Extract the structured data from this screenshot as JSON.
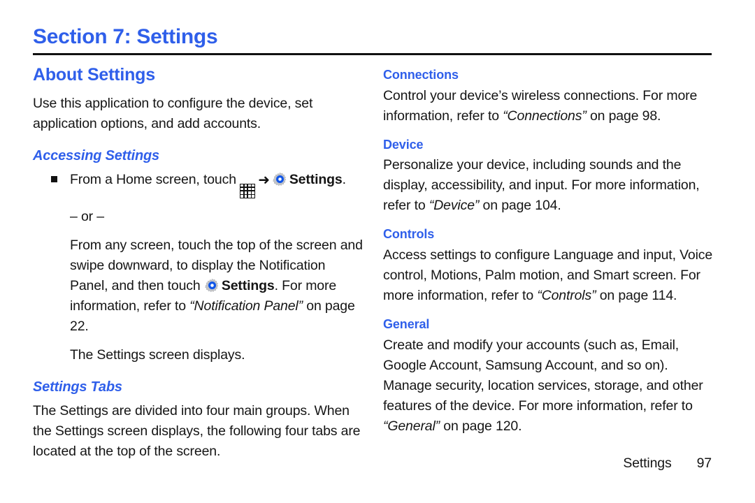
{
  "document": {
    "section_title": "Section 7: Settings",
    "accent_color": "#2F5FEA",
    "text_color": "#151515"
  },
  "left_column": {
    "heading": "About Settings",
    "intro": "Use this application to configure the device, set application options, and add accounts.",
    "accessing": {
      "heading": "Accessing Settings",
      "bullet_text_before_apps_icon": "From a Home screen, touch",
      "apps_icon_name": "apps-grid-icon",
      "arrow_glyph": "➜",
      "settings_icon_name": "settings-gear-icon",
      "bullet_settings_label": "Settings",
      "bullet_text_end": ".",
      "or_separator": "– or –",
      "alt_text_1": "From any screen, touch the top of the screen and swipe downward, to display the Notification Panel, and then touch",
      "alt_settings_label": "Settings",
      "alt_text_2": ". For more information, refer to",
      "alt_reference": "“Notification Panel”",
      "alt_text_3": "on page 22.",
      "result_text": "The Settings screen displays."
    },
    "settings_tabs": {
      "heading": "Settings Tabs",
      "body": "The Settings are divided into four main groups. When the Settings screen displays, the following four tabs are located at the top of the screen."
    }
  },
  "right_column": {
    "groups": [
      {
        "heading": "Connections",
        "text_before_ref": "Control your device’s wireless connections. For more information, refer to",
        "reference": "“Connections”",
        "text_after_ref": "on page 98."
      },
      {
        "heading": "Device",
        "text_before_ref": "Personalize your device, including sounds and the display, accessibility, and input. For more information, refer to",
        "reference": "“Device”",
        "text_after_ref": "on page 104."
      },
      {
        "heading": "Controls",
        "text_before_ref": "Access settings to configure Language and input, Voice control, Motions, Palm motion, and Smart screen. For more information, refer to",
        "reference": "“Controls”",
        "text_after_ref": "on page 114."
      },
      {
        "heading": "General",
        "text_before_ref": "Create and modify your accounts (such as, Email, Google Account, Samsung Account, and so on). Manage security, location services, storage, and other features of the device. For more information, refer to",
        "reference": "“General”",
        "text_after_ref": "on page 120."
      }
    ]
  },
  "footer": {
    "label": "Settings",
    "page_number": "97"
  }
}
